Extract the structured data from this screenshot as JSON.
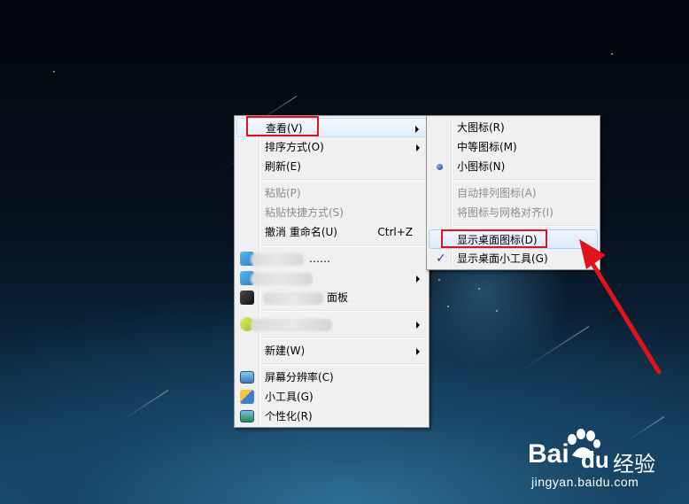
{
  "context_menu": {
    "items": [
      {
        "label": "查看(V)"
      },
      {
        "label": "排序方式(O)"
      },
      {
        "label": "刷新(E)"
      },
      {
        "label": "粘贴(P)"
      },
      {
        "label": "粘贴快捷方式(S)"
      },
      {
        "label": "撤消 重命名(U)",
        "shortcut": "Ctrl+Z"
      },
      {
        "label": "……"
      },
      {
        "label": ""
      },
      {
        "label": "面板"
      },
      {
        "label": ""
      },
      {
        "label": "新建(W)"
      },
      {
        "label": "屏幕分辨率(C)"
      },
      {
        "label": "小工具(G)"
      },
      {
        "label": "个性化(R)"
      }
    ]
  },
  "submenu_view": {
    "items": [
      {
        "label": "大图标(R)"
      },
      {
        "label": "中等图标(M)"
      },
      {
        "label": "小图标(N)"
      },
      {
        "label": "自动排列图标(A)"
      },
      {
        "label": "将图标与网格对齐(I)"
      },
      {
        "label": "显示桌面图标(D)"
      },
      {
        "label": "显示桌面小工具(G)"
      }
    ]
  },
  "watermark": {
    "brand_left": "Bai",
    "brand_right": "经验",
    "url": "jingyan.baidu.com"
  },
  "colors": {
    "annotation_red": "#e0131b",
    "menu_bg": "#f0f0f0",
    "highlight": "#dcebfc"
  }
}
